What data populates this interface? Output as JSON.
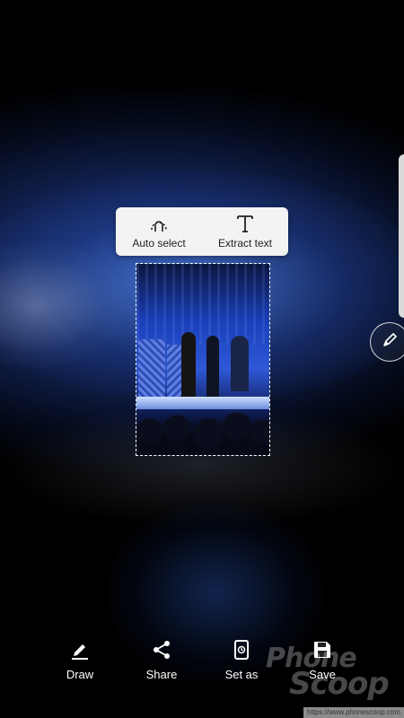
{
  "popup": {
    "auto_select": {
      "label": "Auto select",
      "icon": "auto-select-icon"
    },
    "extract_text": {
      "label": "Extract text",
      "icon": "text-t-icon"
    }
  },
  "side_controls": {
    "pen_icon": "pen-icon",
    "edge_panel_icon": "edge-panel-handle"
  },
  "selection": {
    "content": "concert-photo"
  },
  "toolbar": {
    "draw": {
      "label": "Draw",
      "icon": "pencil-icon"
    },
    "share": {
      "label": "Share",
      "icon": "share-icon"
    },
    "set_as": {
      "label": "Set as",
      "icon": "set-as-icon"
    },
    "save": {
      "label": "Save",
      "icon": "save-icon"
    }
  },
  "watermark": {
    "line1": "Phone",
    "line2": "Scoop"
  },
  "credit": {
    "text": "https://www.phonescoop.com"
  },
  "colors": {
    "popup_bg": "#f3f3f3",
    "label_text": "#ffffff",
    "popup_text": "#222222"
  }
}
